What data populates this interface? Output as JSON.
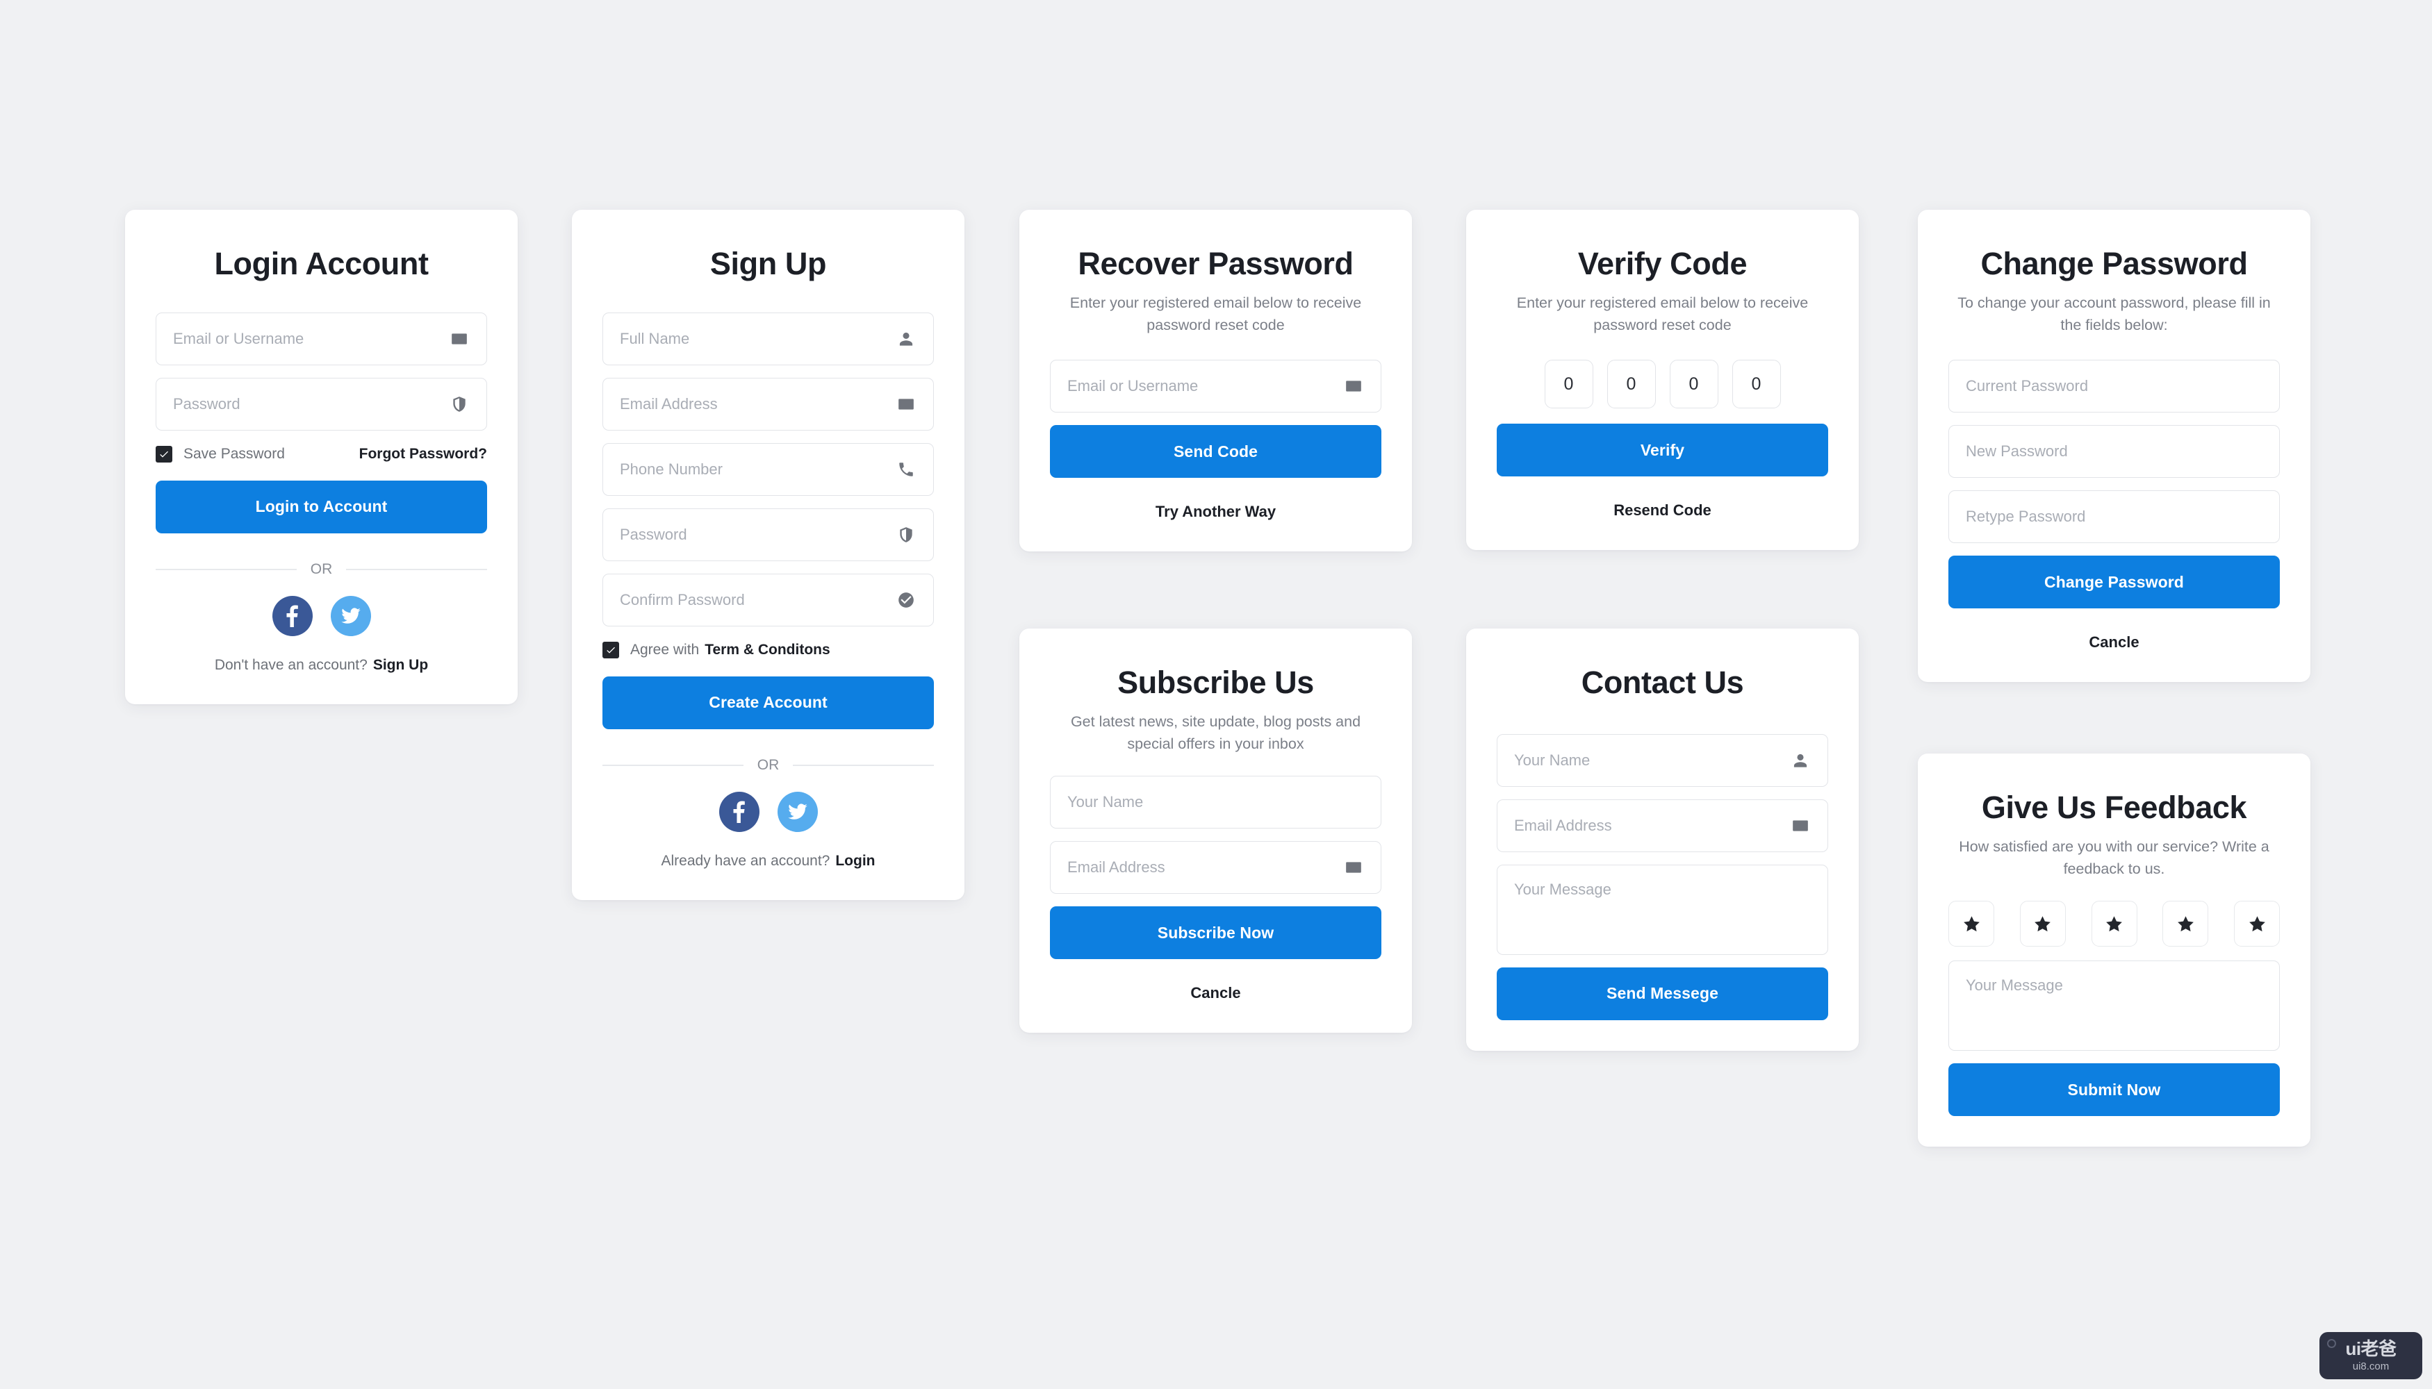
{
  "theme": {
    "background": "#f0f1f3",
    "card_background": "#ffffff",
    "primary": "#0d7fe0",
    "title_color": "#1c1f26",
    "muted_text": "#7b7f88",
    "placeholder": "#a9adb5",
    "border": "#e2e4e8",
    "facebook_blue": "#3a5897",
    "twitter_blue": "#56acee",
    "checkbox_fill": "#23262c"
  },
  "login": {
    "title": "Login Account",
    "email_placeholder": "Email or Username",
    "password_placeholder": "Password",
    "save_password_label": "Save Password",
    "forgot_label": "Forgot Password?",
    "submit_label": "Login to Account",
    "or_label": "OR",
    "footer_text": "Don't have an account?",
    "footer_link": "Sign Up"
  },
  "signup": {
    "title": "Sign Up",
    "fullname_placeholder": "Full Name",
    "email_placeholder": "Email Address",
    "phone_placeholder": "Phone Number",
    "password_placeholder": "Password",
    "confirm_placeholder": "Confirm Password",
    "agree_prefix": "Agree with",
    "agree_link": "Term & Conditons",
    "submit_label": "Create Account",
    "or_label": "OR",
    "footer_text": "Already have an account?",
    "footer_link": "Login"
  },
  "recover": {
    "title": "Recover Password",
    "subtitle": "Enter your registered email below to receive password reset code",
    "email_placeholder": "Email or Username",
    "submit_label": "Send Code",
    "alt_link": "Try Another Way"
  },
  "verify": {
    "title": "Verify Code",
    "subtitle": "Enter your registered email below to receive password reset code",
    "digits": [
      "0",
      "0",
      "0",
      "0"
    ],
    "submit_label": "Verify",
    "alt_link": "Resend Code"
  },
  "change_password": {
    "title": "Change Password",
    "subtitle": "To change your account password, please fill in the fields below:",
    "current_placeholder": "Current Password",
    "new_placeholder": "New Password",
    "retype_placeholder": "Retype Password",
    "submit_label": "Change Password",
    "alt_link": "Cancle"
  },
  "subscribe": {
    "title": "Subscribe Us",
    "subtitle": "Get latest news, site update, blog posts and special offers in your inbox",
    "name_placeholder": "Your Name",
    "email_placeholder": "Email Address",
    "submit_label": "Subscribe Now",
    "alt_link": "Cancle"
  },
  "contact": {
    "title": "Contact Us",
    "name_placeholder": "Your Name",
    "email_placeholder": "Email Address",
    "message_placeholder": "Your Message",
    "submit_label": "Send Messege"
  },
  "feedback": {
    "title": "Give Us Feedback",
    "subtitle": "How satisfied are you with our service? Write a feedback to us.",
    "stars": [
      "star",
      "star",
      "star",
      "star",
      "star"
    ],
    "message_placeholder": "Your Message",
    "submit_label": "Submit Now"
  },
  "watermark": {
    "main": "ui老爸",
    "sub": "ui8.com"
  }
}
